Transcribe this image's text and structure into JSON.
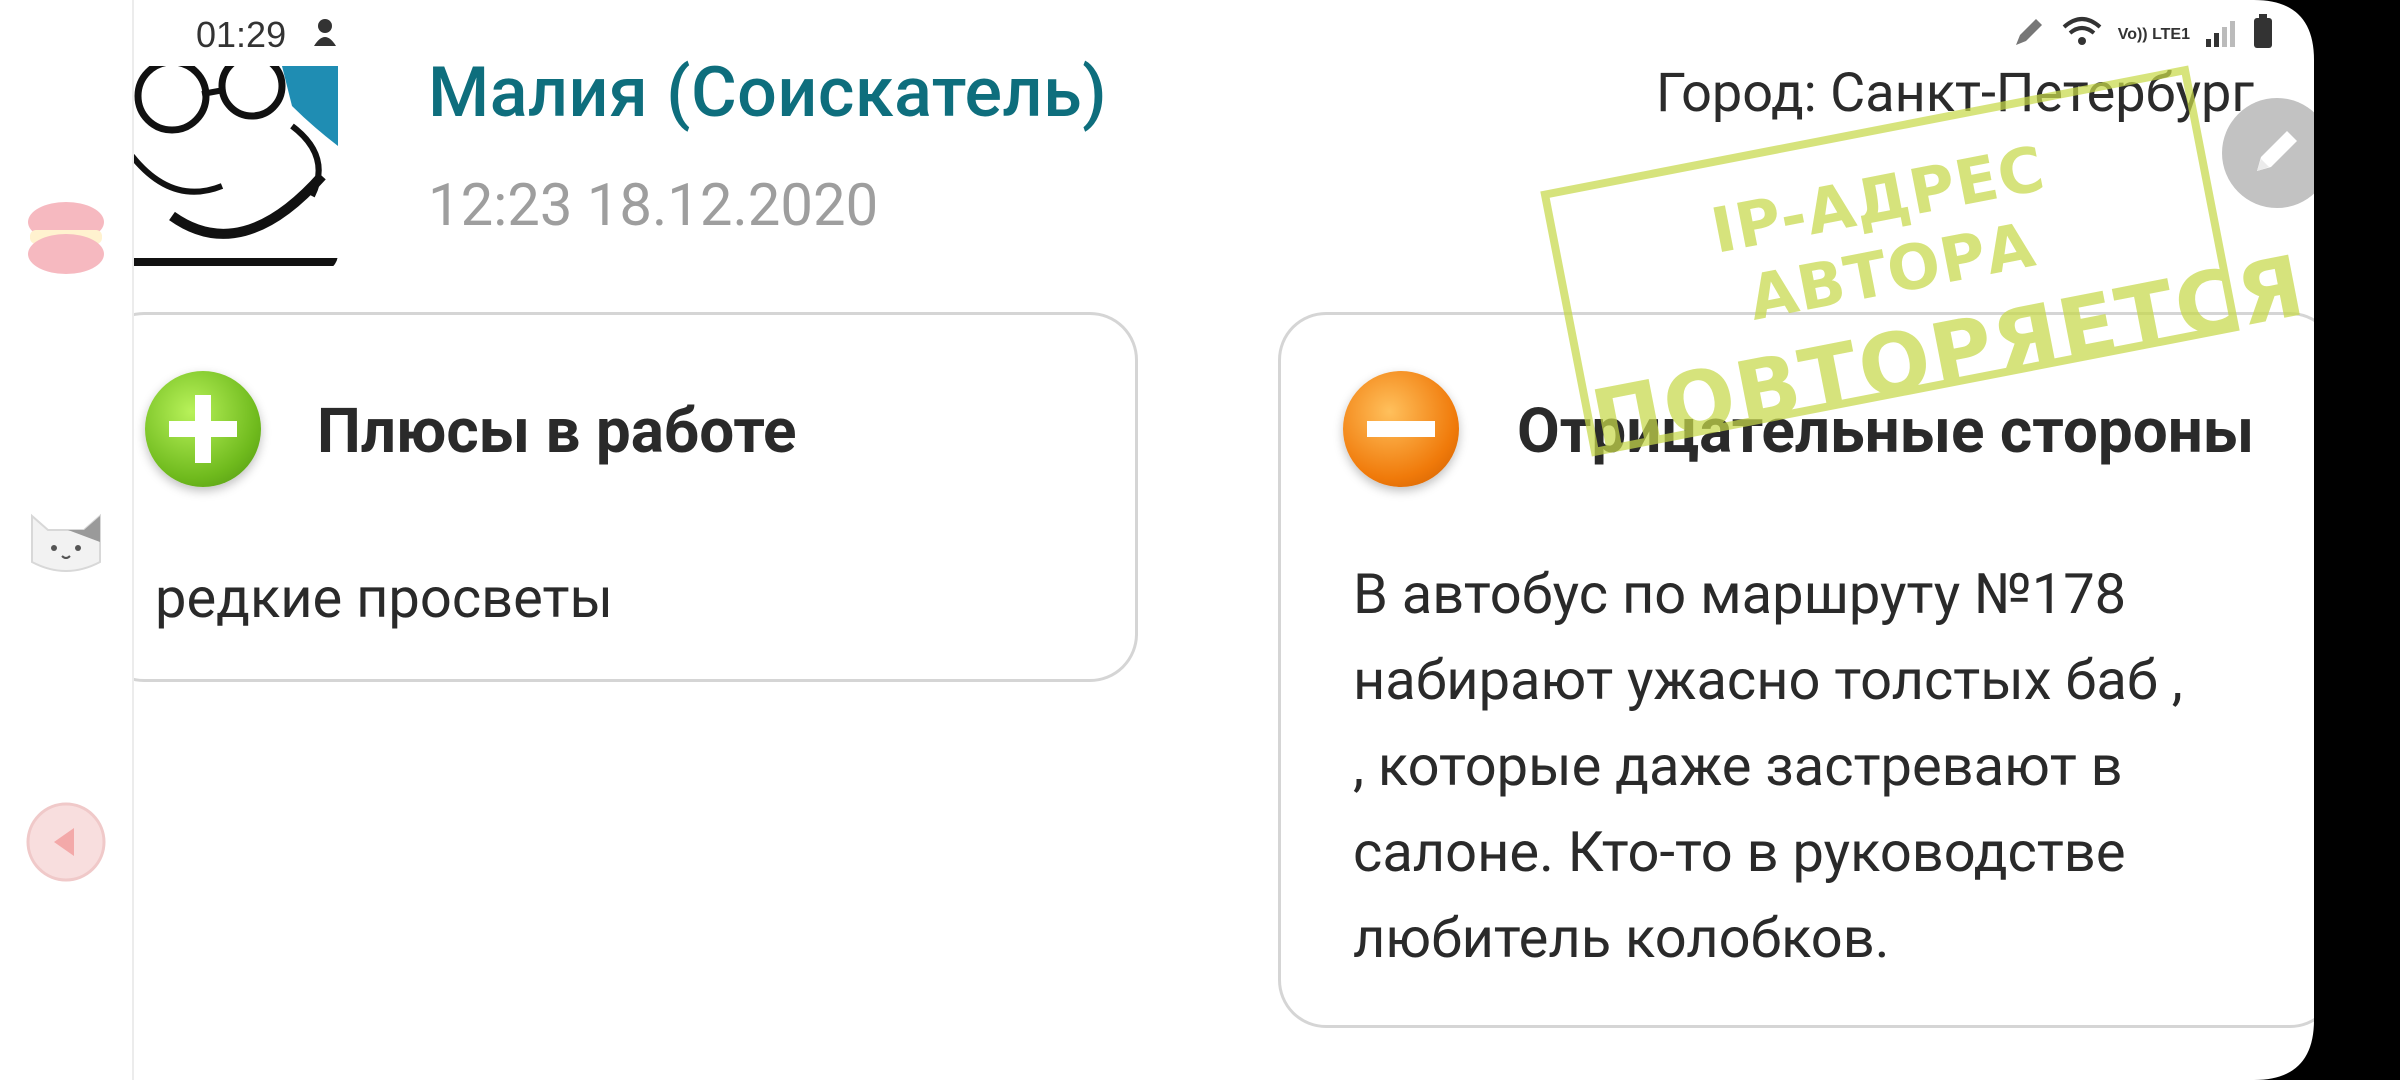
{
  "status_bar": {
    "time": "01:29",
    "network_label": "Vo)) LTE1"
  },
  "review": {
    "author": "Малия (Соискатель)",
    "date": "12:23 18.12.2020",
    "city": "Город: Санкт-Петербург",
    "stamp": {
      "line1": "IP-АДРЕС АВТОРА",
      "line2": "ПОВТОРЯЕТСЯ"
    },
    "pros": {
      "title": "Плюсы в работе",
      "text": "редкие просветы"
    },
    "cons": {
      "title": "Отрицательные стороны",
      "text_lines": [
        "В автобус по маршруту №178",
        "набирают ужасно толстых баб ,",
        ", которые даже застревают в",
        "салоне. Кто-то в руководстве",
        "любитель колобков."
      ]
    }
  },
  "icons": {
    "left_panel": [
      "macaron-icon",
      "cat-icon",
      "back-arrow-icon"
    ],
    "edit": "pencil-icon",
    "pros": "plus-icon",
    "cons": "minus-icon"
  },
  "colors": {
    "accent": "#0e6e7d",
    "pros_icon": "#7cc22a",
    "cons_icon": "#f07a0a",
    "stamp": "#c7d94a"
  }
}
